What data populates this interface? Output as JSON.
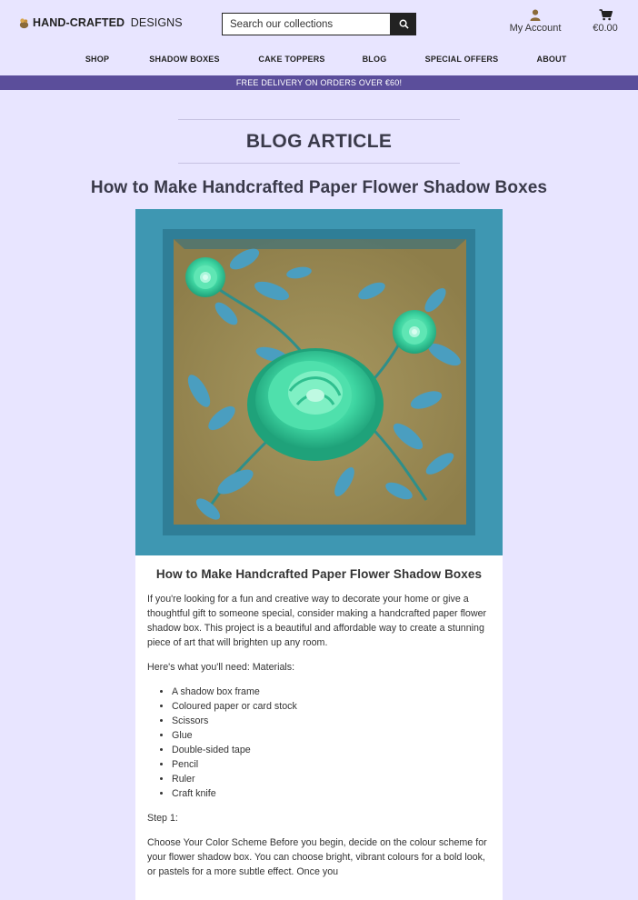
{
  "header": {
    "logo_bold": "HAND-CRAFTED",
    "logo_rest": " DESIGNS",
    "search_placeholder": "Search our collections",
    "account_label": "My Account",
    "cart_total": "€0.00"
  },
  "nav": [
    "SHOP",
    "SHADOW BOXES",
    "CAKE TOPPERS",
    "BLOG",
    "SPECIAL OFFERS",
    "ABOUT"
  ],
  "promo": "FREE DELIVERY ON ORDERS OVER €60!",
  "page_title": "BLOG ARTICLE",
  "article": {
    "title": "How to Make Handcrafted Paper Flower Shadow Boxes",
    "card_title": "How to Make Handcrafted Paper Flower Shadow Boxes",
    "intro": "If you're looking for a fun and creative way to decorate your home or give a thoughtful gift to someone special, consider making a handcrafted paper flower shadow box. This project is a beautiful and affordable way to create a stunning piece of art that will brighten up any room.",
    "needs": "Here's what you'll need: Materials:",
    "materials": [
      "A shadow box frame",
      "Coloured paper or card stock",
      "Scissors",
      "Glue",
      "Double-sided tape",
      "Pencil",
      "Ruler",
      "Craft knife"
    ],
    "step1": "Step 1:",
    "step1_text": "Choose Your Color Scheme Before you begin, decide on the colour scheme for your flower shadow box. You can choose bright, vibrant colours for a bold look, or pastels for a more subtle effect. Once you"
  },
  "colors": {
    "background": "#e8e5ff",
    "promo_bar": "#5b4e9b",
    "frame_teal": "#3e97b2",
    "flower_green": "#3fd6a2"
  }
}
